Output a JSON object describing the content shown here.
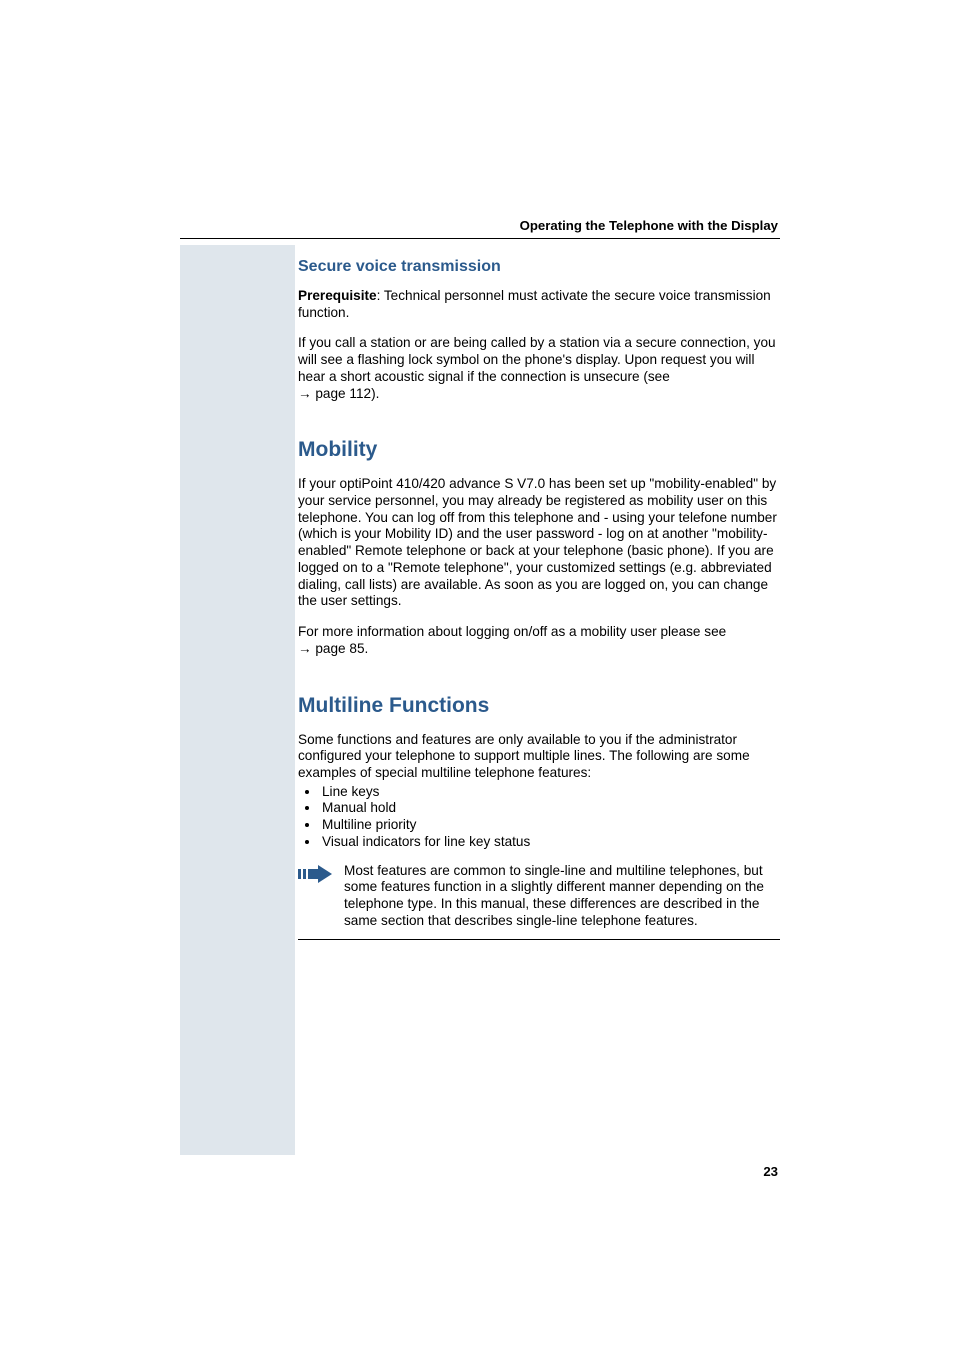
{
  "header": {
    "running_title": "Operating the Telephone with the Display"
  },
  "sections": {
    "secure": {
      "heading": "Secure voice transmission",
      "prereq_label": "Prerequisite",
      "prereq_rest": ": Technical personnel must activate the secure voice transmission function.",
      "body": "If you call a station or are being called by a station via a secure connection, you will see a flashing lock symbol on the phone's display. Upon request you will hear a short acoustic signal if the connection is unsecure (see ",
      "body_ref": "page 112).",
      "arrow": "→ "
    },
    "mobility": {
      "heading": "Mobility",
      "body1": "If your optiPoint 410/420 advance S V7.0 has been set up \"mobility-enabled\" by your service personnel, you may already be registered as mobility user on this telephone. You can log off from this telephone and - using your telefone number (which is your Mobility ID) and the user password - log on at another \"mobility-enabled\" Remote telephone or back at your telephone (basic phone). If you are logged on to a \"Remote telephone\", your customized settings (e.g. abbreviated dialing, call lists) are available. As soon as you are logged on, you can change the user settings.",
      "body2_pre": "For more information about logging on/off as a mobility user please see ",
      "body2_ref": "page 85.",
      "arrow": "→ "
    },
    "multiline": {
      "heading": "Multiline Functions",
      "intro": "Some functions and features are only available to you if the administrator configured your telephone to support multiple lines. The following are some examples of special multiline telephone features:",
      "bullets": [
        "Line keys",
        "Manual hold",
        "Multiline priority",
        "Visual indicators for line key status"
      ],
      "note": "Most features are common to single-line and multiline telephones, but some features function in a slightly different manner depending on the telephone type. In this manual, these differences are described in the same section that describes single-line telephone features."
    }
  },
  "footer": {
    "page_number": "23"
  }
}
